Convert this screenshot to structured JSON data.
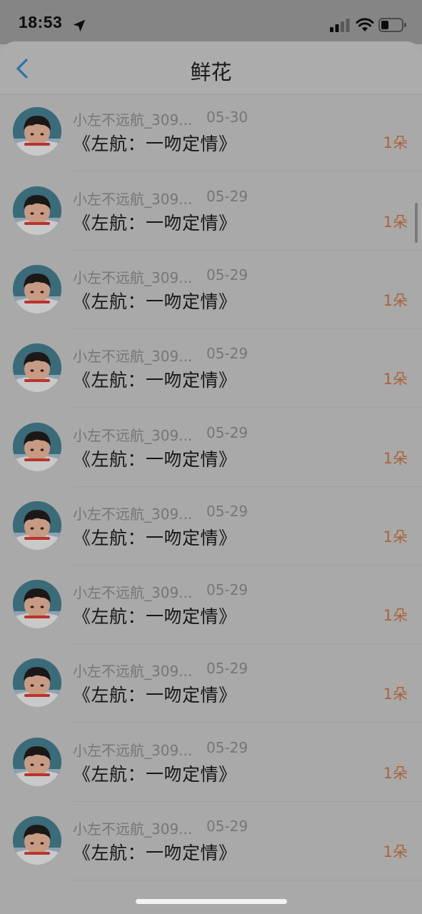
{
  "status_bar": {
    "time": "18:53",
    "icons": [
      "location-arrow-icon",
      "cellular-signal-icon",
      "wifi-icon",
      "battery-icon"
    ]
  },
  "header": {
    "title": "鲜花",
    "back_icon": "chevron-left-icon",
    "accent_color": "#2f6fa5"
  },
  "list": {
    "items": [
      {
        "user": "",
        "date": "",
        "gift": "《左航：一吻定情》",
        "count": "1朵"
      },
      {
        "user": "小左不远航_309...",
        "date": "05-30",
        "gift": "《左航：一吻定情》",
        "count": "1朵"
      },
      {
        "user": "小左不远航_309...",
        "date": "05-29",
        "gift": "《左航：一吻定情》",
        "count": "1朵"
      },
      {
        "user": "小左不远航_309...",
        "date": "05-29",
        "gift": "《左航：一吻定情》",
        "count": "1朵"
      },
      {
        "user": "小左不远航_309...",
        "date": "05-29",
        "gift": "《左航：一吻定情》",
        "count": "1朵"
      },
      {
        "user": "小左不远航_309...",
        "date": "05-29",
        "gift": "《左航：一吻定情》",
        "count": "1朵"
      },
      {
        "user": "小左不远航_309...",
        "date": "05-29",
        "gift": "《左航：一吻定情》",
        "count": "1朵"
      },
      {
        "user": "小左不远航_309...",
        "date": "05-29",
        "gift": "《左航：一吻定情》",
        "count": "1朵"
      },
      {
        "user": "小左不远航_309...",
        "date": "05-29",
        "gift": "《左航：一吻定情》",
        "count": "1朵"
      },
      {
        "user": "小左不远航_309...",
        "date": "05-29",
        "gift": "《左航：一吻定情》",
        "count": "1朵"
      },
      {
        "user": "小左不远航_309...",
        "date": "05-29",
        "gift": "《左航：一吻定情》",
        "count": "1朵"
      }
    ],
    "count_color": "#a9623a"
  }
}
